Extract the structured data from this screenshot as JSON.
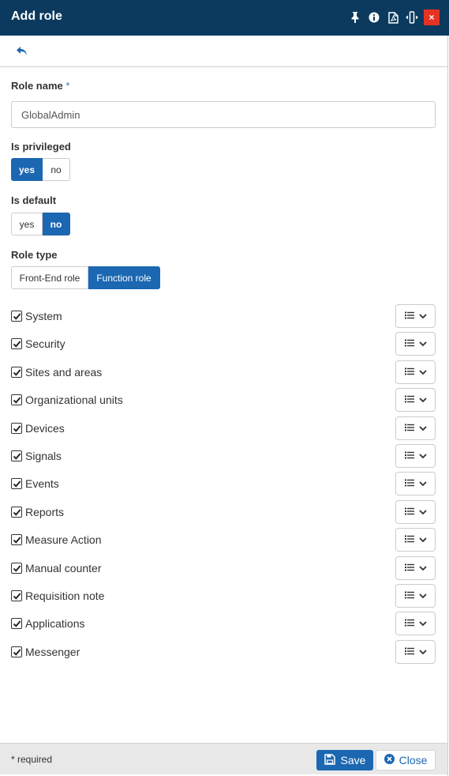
{
  "window": {
    "title": "Add role",
    "toolbar_icons": [
      "pin-icon",
      "info-icon",
      "pdf-icon",
      "resize-icon"
    ],
    "close_label": "×"
  },
  "form": {
    "role_name": {
      "label": "Role name",
      "required_mark": "*",
      "value": "GlobalAdmin"
    },
    "is_privileged": {
      "label": "Is privileged",
      "options": [
        "yes",
        "no"
      ],
      "selected": "yes"
    },
    "is_default": {
      "label": "Is default",
      "options": [
        "yes",
        "no"
      ],
      "selected": "no"
    },
    "role_type": {
      "label": "Role type",
      "options": [
        "Front-End role",
        "Function role"
      ],
      "selected": "Function role"
    }
  },
  "permissions": [
    {
      "label": "System",
      "checked": true
    },
    {
      "label": "Security",
      "checked": true
    },
    {
      "label": "Sites and areas",
      "checked": true
    },
    {
      "label": "Organizational units",
      "checked": true
    },
    {
      "label": "Devices",
      "checked": true
    },
    {
      "label": "Signals",
      "checked": true
    },
    {
      "label": "Events",
      "checked": true
    },
    {
      "label": "Reports",
      "checked": true
    },
    {
      "label": "Measure Action",
      "checked": true
    },
    {
      "label": "Manual counter",
      "checked": true
    },
    {
      "label": "Requisition note",
      "checked": true
    },
    {
      "label": "Applications",
      "checked": true
    },
    {
      "label": "Messenger",
      "checked": true
    }
  ],
  "footer": {
    "required_note": "* required",
    "save_label": "Save",
    "close_label": "Close"
  },
  "colors": {
    "titlebar": "#0b3a5e",
    "accent": "#1b67b1",
    "close": "#e53222"
  }
}
